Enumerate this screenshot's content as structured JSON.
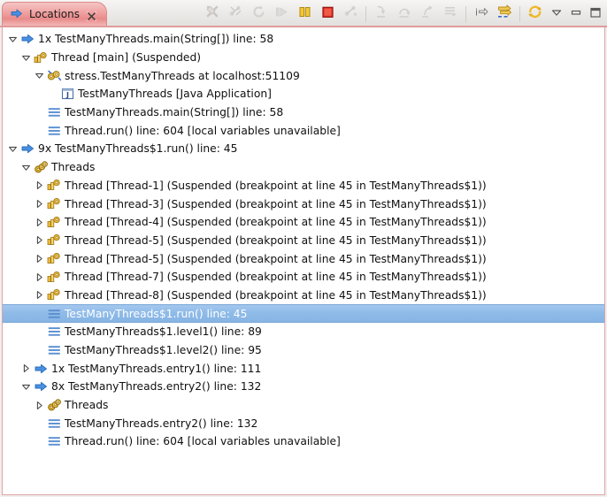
{
  "window": {
    "title": "Locations",
    "tab_icon": "right-arrow-icon",
    "close_icon": "close-icon"
  },
  "toolbar": {
    "buttons": [
      {
        "name": "disconnect-button",
        "icon": "disconnect-icon",
        "enabled": false
      },
      {
        "name": "remove-all-terminated-button",
        "icon": "remove-terminated-icon",
        "enabled": false
      },
      {
        "name": "relaunch-button",
        "icon": "relaunch-icon",
        "enabled": false
      },
      {
        "name": "resume-button",
        "icon": "resume-icon",
        "enabled": false
      },
      {
        "name": "suspend-button",
        "icon": "suspend-icon",
        "enabled": true
      },
      {
        "name": "terminate-button",
        "icon": "terminate-icon",
        "enabled": true
      },
      {
        "name": "disconnect-target-button",
        "icon": "disconnect-target-icon",
        "enabled": false
      },
      {
        "name": "separator-1",
        "icon": "separator",
        "enabled": false
      },
      {
        "name": "step-into-button",
        "icon": "step-into-icon",
        "enabled": false
      },
      {
        "name": "step-over-button",
        "icon": "step-over-icon",
        "enabled": false
      },
      {
        "name": "step-return-button",
        "icon": "step-return-icon",
        "enabled": false
      },
      {
        "name": "drop-to-frame-button",
        "icon": "drop-to-frame-icon",
        "enabled": false
      },
      {
        "name": "separator-2",
        "icon": "separator",
        "enabled": false
      },
      {
        "name": "use-step-filters-button",
        "icon": "step-filters-icon",
        "enabled": true
      },
      {
        "name": "instruction-stepping-button",
        "icon": "instruction-step-icon",
        "enabled": true
      },
      {
        "name": "separator-3",
        "icon": "separator",
        "enabled": false
      },
      {
        "name": "refresh-button",
        "icon": "refresh-icon",
        "enabled": true
      },
      {
        "name": "view-menu-button",
        "icon": "chevron-down-icon",
        "enabled": true
      },
      {
        "name": "minimize-button",
        "icon": "minimize-icon",
        "enabled": true
      },
      {
        "name": "maximize-button",
        "icon": "maximize-icon",
        "enabled": true
      }
    ]
  },
  "tree": {
    "rows": [
      {
        "indent": 0,
        "twisty": "expanded",
        "icon": "launch-arrow-icon",
        "label": "1x TestManyThreads.main(String[]) line: 58",
        "selected": false
      },
      {
        "indent": 1,
        "twisty": "expanded",
        "icon": "thread-icon",
        "label": "Thread [main] (Suspended)",
        "selected": false
      },
      {
        "indent": 2,
        "twisty": "expanded",
        "icon": "debug-target-icon",
        "label": "stress.TestManyThreads at localhost:51109",
        "selected": false
      },
      {
        "indent": 3,
        "twisty": "none",
        "icon": "java-application-icon",
        "label": "TestManyThreads [Java Application]",
        "selected": false
      },
      {
        "indent": 2,
        "twisty": "none",
        "icon": "stack-frame-icon",
        "label": "TestManyThreads.main(String[]) line: 58",
        "selected": false
      },
      {
        "indent": 2,
        "twisty": "none",
        "icon": "stack-frame-icon",
        "label": "Thread.run() line: 604 [local variables unavailable]",
        "selected": false
      },
      {
        "indent": 0,
        "twisty": "expanded",
        "icon": "launch-arrow-icon",
        "label": "9x TestManyThreads$1.run() line: 45",
        "selected": false
      },
      {
        "indent": 1,
        "twisty": "expanded",
        "icon": "threads-group-icon",
        "label": "Threads",
        "selected": false
      },
      {
        "indent": 2,
        "twisty": "collapsed",
        "icon": "thread-icon",
        "label": "Thread [Thread-1] (Suspended (breakpoint at line 45 in TestManyThreads$1))",
        "selected": false
      },
      {
        "indent": 2,
        "twisty": "collapsed",
        "icon": "thread-icon",
        "label": "Thread [Thread-3] (Suspended (breakpoint at line 45 in TestManyThreads$1))",
        "selected": false
      },
      {
        "indent": 2,
        "twisty": "collapsed",
        "icon": "thread-icon",
        "label": "Thread [Thread-4] (Suspended (breakpoint at line 45 in TestManyThreads$1))",
        "selected": false
      },
      {
        "indent": 2,
        "twisty": "collapsed",
        "icon": "thread-icon",
        "label": "Thread [Thread-5] (Suspended (breakpoint at line 45 in TestManyThreads$1))",
        "selected": false
      },
      {
        "indent": 2,
        "twisty": "collapsed",
        "icon": "thread-icon",
        "label": "Thread [Thread-5] (Suspended (breakpoint at line 45 in TestManyThreads$1))",
        "selected": false
      },
      {
        "indent": 2,
        "twisty": "collapsed",
        "icon": "thread-icon",
        "label": "Thread [Thread-7] (Suspended (breakpoint at line 45 in TestManyThreads$1))",
        "selected": false
      },
      {
        "indent": 2,
        "twisty": "collapsed",
        "icon": "thread-icon",
        "label": "Thread [Thread-8] (Suspended (breakpoint at line 45 in TestManyThreads$1))",
        "selected": false
      },
      {
        "indent": 2,
        "twisty": "none",
        "icon": "stack-frame-icon",
        "label": "TestManyThreads$1.run() line: 45",
        "selected": true
      },
      {
        "indent": 2,
        "twisty": "none",
        "icon": "stack-frame-icon",
        "label": "TestManyThreads$1.level1() line: 89",
        "selected": false
      },
      {
        "indent": 2,
        "twisty": "none",
        "icon": "stack-frame-icon",
        "label": "TestManyThreads$1.level2() line: 95",
        "selected": false
      },
      {
        "indent": 1,
        "twisty": "collapsed",
        "icon": "launch-arrow-icon",
        "label": "1x TestManyThreads.entry1() line: 111",
        "selected": false
      },
      {
        "indent": 1,
        "twisty": "expanded",
        "icon": "launch-arrow-icon",
        "label": "8x TestManyThreads.entry2() line: 132",
        "selected": false
      },
      {
        "indent": 2,
        "twisty": "collapsed",
        "icon": "threads-group-icon",
        "label": "Threads",
        "selected": false
      },
      {
        "indent": 2,
        "twisty": "none",
        "icon": "stack-frame-icon",
        "label": "TestManyThreads.entry2() line: 132",
        "selected": false
      },
      {
        "indent": 2,
        "twisty": "none",
        "icon": "stack-frame-icon",
        "label": "Thread.run() line: 604 [local variables unavailable]",
        "selected": false
      }
    ]
  },
  "colors": {
    "tab_accent": "#ef9e9e",
    "selection": "#8fbbe8",
    "border": "#dfa3a3",
    "thread_gold": "#e8a825",
    "arrow_blue": "#3b7dd8"
  }
}
